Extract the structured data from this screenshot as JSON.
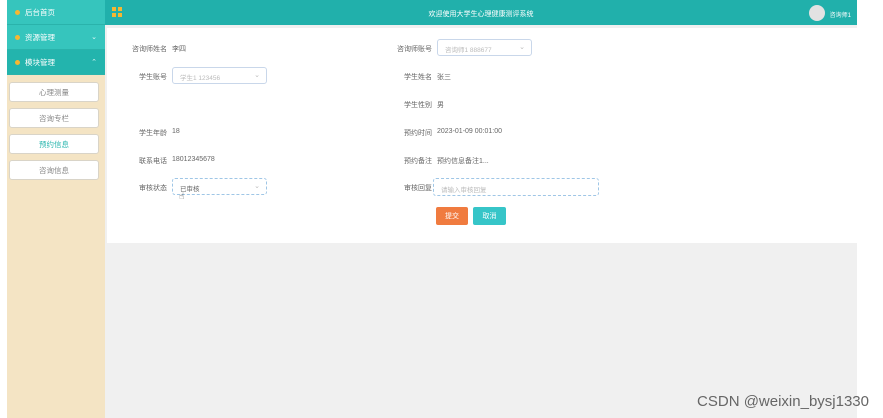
{
  "sidebar": {
    "home": "后台首页",
    "groups": [
      {
        "label": "资源管理"
      },
      {
        "label": "模块管理"
      }
    ],
    "items": [
      {
        "label": "心理测量"
      },
      {
        "label": "咨询专栏"
      },
      {
        "label": "预约信息"
      },
      {
        "label": "咨询信息"
      }
    ]
  },
  "header": {
    "title": "欢迎使用大学生心理健康测评系统",
    "user": "咨询师1"
  },
  "form": {
    "counselor_name": {
      "label": "咨询师姓名",
      "value": "李四"
    },
    "counselor_account": {
      "label": "咨询师账号",
      "value": "咨询师1 888677"
    },
    "student_account": {
      "label": "学生账号",
      "value": "学生1 123456"
    },
    "student_name": {
      "label": "学生姓名",
      "value": "张三"
    },
    "student_gender": {
      "label": "学生性别",
      "value": "男"
    },
    "student_age": {
      "label": "学生年龄",
      "value": "18"
    },
    "appointment_time": {
      "label": "预约时间",
      "value": "2023-01-09 00:01:00"
    },
    "phone": {
      "label": "联系电话",
      "value": "18012345678"
    },
    "appointment_note": {
      "label": "预约备注",
      "value": "预约信息备注1..."
    },
    "review_status": {
      "label": "审核状态",
      "value": "已审核"
    },
    "review_reply": {
      "label": "审核回复",
      "placeholder": "请输入审核回复"
    },
    "submit": "提交",
    "cancel": "取消"
  },
  "icons": [
    "grid-icon",
    "chevron-down-icon",
    "avatar",
    "pointer-cursor-icon"
  ],
  "colors": {
    "sidebar_bg": "#f4e4c4",
    "header_bg": "#21b0ab",
    "menu_teal": "#36c5bd",
    "accent_orange": "#f07b3f",
    "accent_cyan": "#36c5c8"
  },
  "watermark": "CSDN @weixin_bysj1330"
}
